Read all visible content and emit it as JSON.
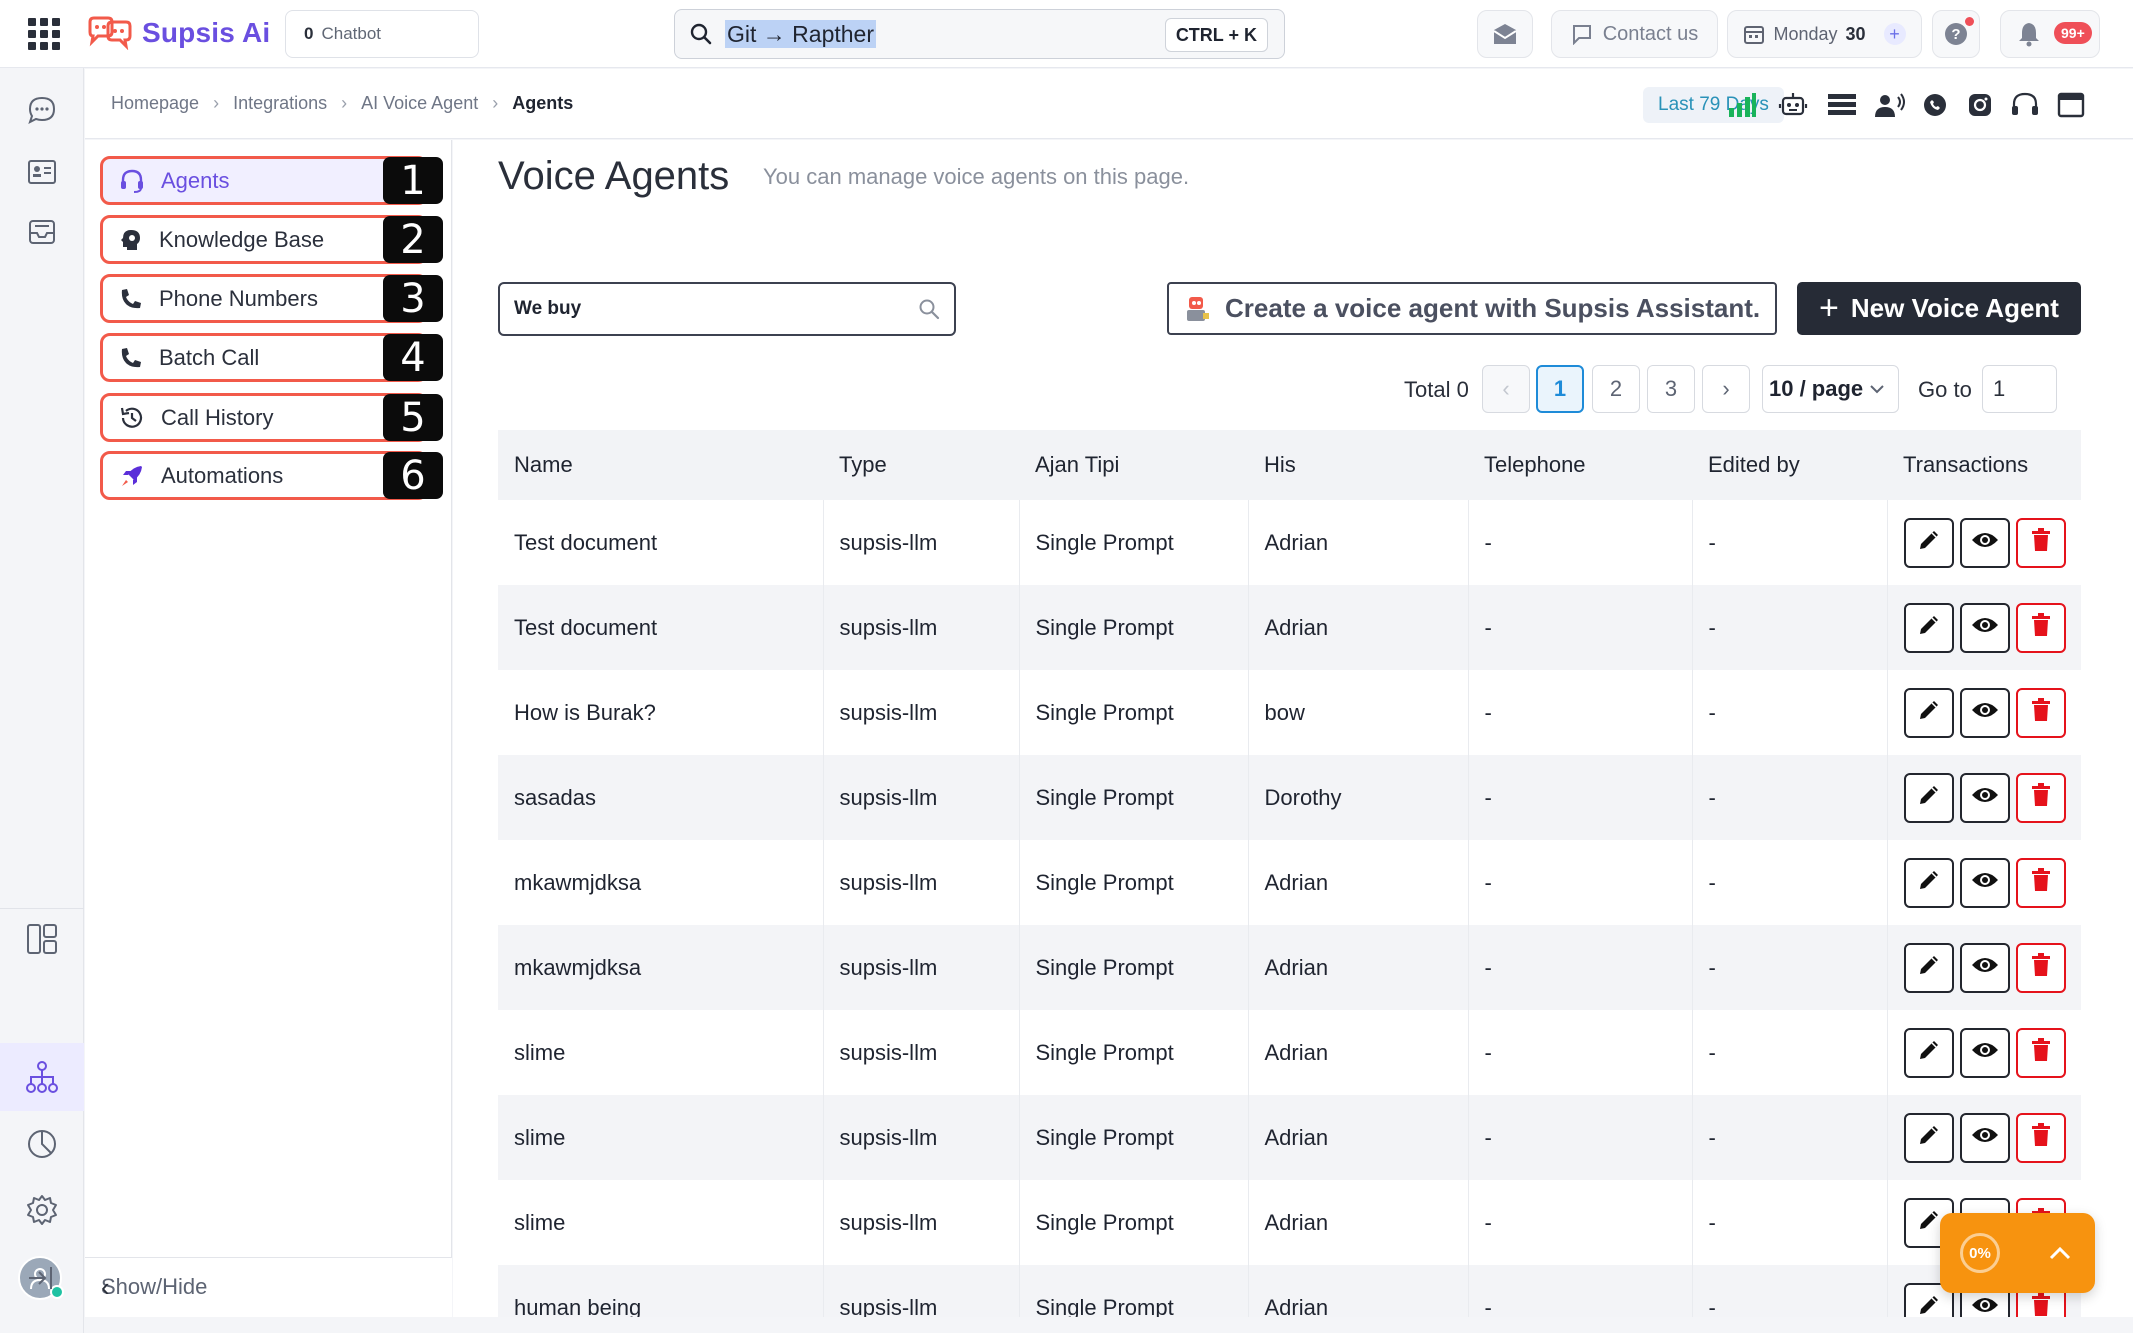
{
  "topbar": {
    "brand": "Supsis Ai",
    "chatbot_count": "0",
    "chatbot_label": "Chatbot",
    "search_value": "Git → Rapther",
    "search_shortcut": "CTRL + K",
    "contact_label": "Contact us",
    "date_day": "Monday",
    "date_num": "30",
    "notif_badge": "99+"
  },
  "breadcrumb": {
    "items": [
      "Homepage",
      "Integrations",
      "AI Voice Agent"
    ],
    "current": "Agents",
    "range_label": "Last 79 Days"
  },
  "sidebar": {
    "items": [
      {
        "label": "Agents",
        "num": "1",
        "icon": "headset-icon"
      },
      {
        "label": "Knowledge Base",
        "num": "2",
        "icon": "brain-icon"
      },
      {
        "label": "Phone Numbers",
        "num": "3",
        "icon": "phone-icon"
      },
      {
        "label": "Batch Call",
        "num": "4",
        "icon": "phone-icon"
      },
      {
        "label": "Call History",
        "num": "5",
        "icon": "history-icon"
      },
      {
        "label": "Automations",
        "num": "6",
        "icon": "rocket-icon"
      }
    ],
    "showhide_label": "Show/Hide"
  },
  "main": {
    "title": "Voice Agents",
    "subtitle": "You can manage voice agents on this page.",
    "search_value": "We buy",
    "assistant_label": "Create a voice agent with Supsis Assistant.",
    "new_label": "New Voice Agent"
  },
  "pagination": {
    "total": "Total 0",
    "pages": [
      "1",
      "2",
      "3"
    ],
    "current_page": "1",
    "page_size": "10 / page",
    "goto_label": "Go to",
    "goto_value": "1"
  },
  "table": {
    "headers": [
      "Name",
      "Type",
      "Ajan Tipi",
      "His",
      "Telephone",
      "Edited by",
      "Transactions"
    ],
    "rows": [
      {
        "name": "Test document",
        "type": "supsis-llm",
        "agent_type": "Single Prompt",
        "his": "Adrian",
        "telephone": "-",
        "edited_by": "-"
      },
      {
        "name": "Test document",
        "type": "supsis-llm",
        "agent_type": "Single Prompt",
        "his": "Adrian",
        "telephone": "-",
        "edited_by": "-"
      },
      {
        "name": "How is Burak?",
        "type": "supsis-llm",
        "agent_type": "Single Prompt",
        "his": "bow",
        "telephone": "-",
        "edited_by": "-"
      },
      {
        "name": "sasadas",
        "type": "supsis-llm",
        "agent_type": "Single Prompt",
        "his": "Dorothy",
        "telephone": "-",
        "edited_by": "-"
      },
      {
        "name": "mkawmjdksa",
        "type": "supsis-llm",
        "agent_type": "Single Prompt",
        "his": "Adrian",
        "telephone": "-",
        "edited_by": "-"
      },
      {
        "name": "mkawmjdksa",
        "type": "supsis-llm",
        "agent_type": "Single Prompt",
        "his": "Adrian",
        "telephone": "-",
        "edited_by": "-"
      },
      {
        "name": "slime",
        "type": "supsis-llm",
        "agent_type": "Single Prompt",
        "his": "Adrian",
        "telephone": "-",
        "edited_by": "-"
      },
      {
        "name": "slime",
        "type": "supsis-llm",
        "agent_type": "Single Prompt",
        "his": "Adrian",
        "telephone": "-",
        "edited_by": "-"
      },
      {
        "name": "slime",
        "type": "supsis-llm",
        "agent_type": "Single Prompt",
        "his": "Adrian",
        "telephone": "-",
        "edited_by": "-"
      },
      {
        "name": "human being",
        "type": "supsis-llm",
        "agent_type": "Single Prompt",
        "his": "Adrian",
        "telephone": "-",
        "edited_by": "-"
      }
    ]
  },
  "fab": {
    "progress_label": "0%",
    "progress": 0
  },
  "colors": {
    "accent": "#6a4fe0",
    "highlight_border": "#f25a4a",
    "primary_button": "#262b36",
    "delete": "#e5121b",
    "fab": "#f7930f",
    "link_blue": "#1e8bd8"
  }
}
